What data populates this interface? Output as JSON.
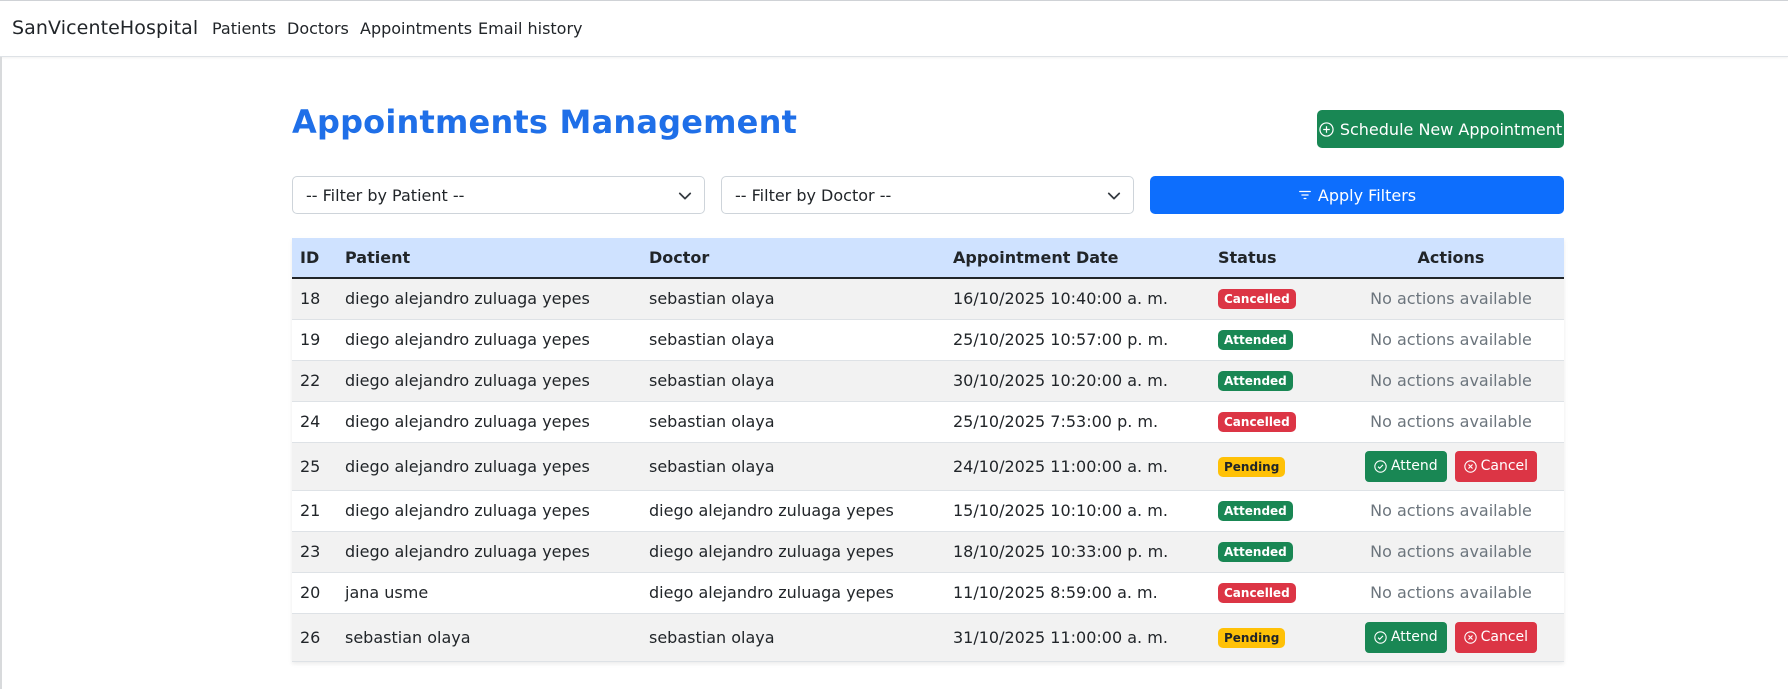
{
  "navbar": {
    "brand": "SanVicenteHospital",
    "links": [
      "Patients",
      "Doctors",
      "Appointments",
      "Email history"
    ]
  },
  "page": {
    "title": "Appointments Management",
    "schedule_label": "Schedule New Appointment"
  },
  "filters": {
    "patient_label": "-- Filter by Patient --",
    "doctor_label": "-- Filter by Doctor --",
    "apply_label": "Apply Filters"
  },
  "table": {
    "headers": [
      "ID",
      "Patient",
      "Doctor",
      "Appointment Date",
      "Status",
      "Actions"
    ],
    "no_actions_text": "No actions available",
    "attend_label": "Attend",
    "cancel_label": "Cancel",
    "rows": [
      {
        "id": "18",
        "patient": "diego alejandro zuluaga yepes",
        "doctor": "sebastian olaya",
        "date": "16/10/2025 10:40:00 a. m.",
        "status": "Cancelled"
      },
      {
        "id": "19",
        "patient": "diego alejandro zuluaga yepes",
        "doctor": "sebastian olaya",
        "date": "25/10/2025 10:57:00 p. m.",
        "status": "Attended"
      },
      {
        "id": "22",
        "patient": "diego alejandro zuluaga yepes",
        "doctor": "sebastian olaya",
        "date": "30/10/2025 10:20:00 a. m.",
        "status": "Attended"
      },
      {
        "id": "24",
        "patient": "diego alejandro zuluaga yepes",
        "doctor": "sebastian olaya",
        "date": "25/10/2025 7:53:00 p. m.",
        "status": "Cancelled"
      },
      {
        "id": "25",
        "patient": "diego alejandro zuluaga yepes",
        "doctor": "sebastian olaya",
        "date": "24/10/2025 11:00:00 a. m.",
        "status": "Pending"
      },
      {
        "id": "21",
        "patient": "diego alejandro zuluaga yepes",
        "doctor": "diego alejandro zuluaga yepes",
        "date": "15/10/2025 10:10:00 a. m.",
        "status": "Attended"
      },
      {
        "id": "23",
        "patient": "diego alejandro zuluaga yepes",
        "doctor": "diego alejandro zuluaga yepes",
        "date": "18/10/2025 10:33:00 p. m.",
        "status": "Attended"
      },
      {
        "id": "20",
        "patient": "jana usme",
        "doctor": "diego alejandro zuluaga yepes",
        "date": "11/10/2025 8:59:00 a. m.",
        "status": "Cancelled"
      },
      {
        "id": "26",
        "patient": "sebastian olaya",
        "doctor": "sebastian olaya",
        "date": "31/10/2025 11:00:00 a. m.",
        "status": "Pending"
      }
    ]
  },
  "colors": {
    "title": "#1f6fe8",
    "primary": "#0d6efd",
    "success": "#198754",
    "danger": "#dc3545",
    "warning": "#ffc107",
    "header_bg": "#cfe2ff"
  },
  "icons": {
    "schedule": "plus-circle-icon",
    "apply": "filter-icon",
    "select": "chevron-down-icon",
    "attend": "check-circle-icon",
    "cancel": "x-circle-icon"
  }
}
